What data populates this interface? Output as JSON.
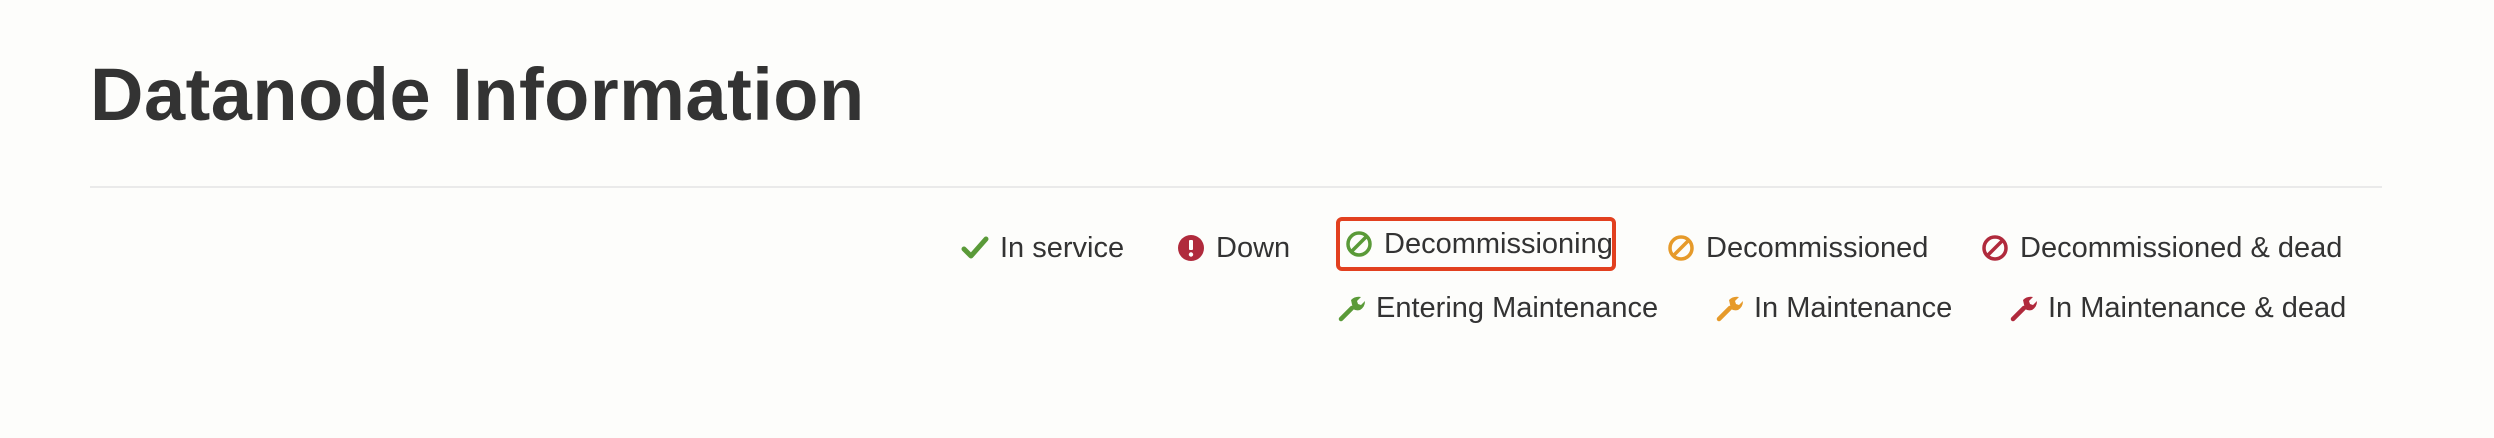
{
  "page": {
    "title": "Datanode Information"
  },
  "legend": {
    "row1": [
      {
        "label": "In service",
        "icon": "checkmark-icon",
        "color": "#5a9a38"
      },
      {
        "label": "Down",
        "icon": "exclamation-icon",
        "color": "#b02a3c"
      },
      {
        "label": "Decommissioning",
        "icon": "ban-icon",
        "color": "#5a9a38",
        "highlighted": true
      },
      {
        "label": "Decommissioned",
        "icon": "ban-icon",
        "color": "#e69a2a"
      },
      {
        "label": "Decommissioned & dead",
        "icon": "ban-icon",
        "color": "#b02a3c"
      }
    ],
    "row2": [
      {
        "label": "Entering Maintenance",
        "icon": "wrench-icon",
        "color": "#5a9a38"
      },
      {
        "label": "In Maintenance",
        "icon": "wrench-icon",
        "color": "#e69a2a"
      },
      {
        "label": "In Maintenance & dead",
        "icon": "wrench-icon",
        "color": "#b02a3c"
      }
    ]
  },
  "colors": {
    "highlight_border": "#e2401f",
    "background": "#fdfdfb",
    "divider": "#eaeaea"
  }
}
